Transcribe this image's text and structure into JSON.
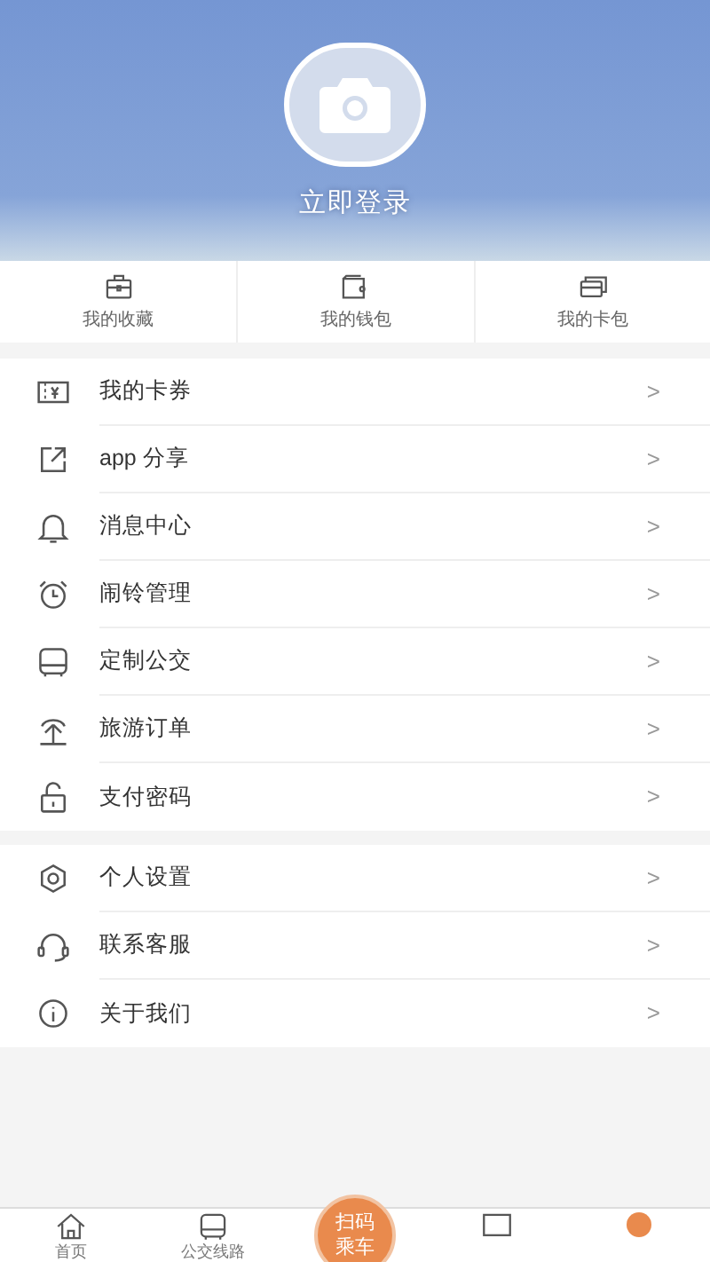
{
  "header": {
    "login_label": "立即登录"
  },
  "quick_actions": [
    {
      "kind": "favorites",
      "label": "我的收藏"
    },
    {
      "kind": "wallet",
      "label": "我的钱包"
    },
    {
      "kind": "cards",
      "label": "我的卡包"
    }
  ],
  "menu_groups": [
    [
      {
        "kind": "coupon",
        "label": "我的卡券",
        "chevron": ">"
      },
      {
        "kind": "share",
        "label": "app 分享",
        "chevron": ">"
      },
      {
        "kind": "bell",
        "label": "消息中心",
        "chevron": ">"
      },
      {
        "kind": "alarm",
        "label": "闹铃管理",
        "chevron": ">"
      },
      {
        "kind": "bus",
        "label": "定制公交",
        "chevron": ">"
      },
      {
        "kind": "palm",
        "label": "旅游订单",
        "chevron": ">"
      },
      {
        "kind": "lock",
        "label": "支付密码",
        "chevron": ">"
      }
    ],
    [
      {
        "kind": "settings",
        "label": "个人设置",
        "chevron": ">"
      },
      {
        "kind": "headset",
        "label": "联系客服",
        "chevron": ">"
      },
      {
        "kind": "info",
        "label": "关于我们",
        "chevron": ">"
      }
    ]
  ],
  "tab_bar": [
    {
      "kind": "home",
      "label": "首页"
    },
    {
      "kind": "bus",
      "label": "公交线路"
    },
    {
      "kind": "scan",
      "label": "扫码乘车"
    },
    {
      "kind": "screen"
    },
    {
      "kind": "user"
    }
  ]
}
